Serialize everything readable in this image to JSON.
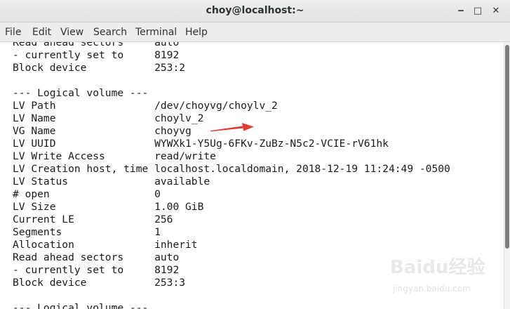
{
  "window": {
    "title": "choy@localhost:~",
    "minimize_glyph": "‒",
    "maximize_glyph": "□",
    "close_glyph": "✕"
  },
  "menu": [
    "File",
    "Edit",
    "View",
    "Search",
    "Terminal",
    "Help"
  ],
  "terminal": {
    "lines": [
      "Read ahead sectors     auto",
      "- currently set to     8192",
      "Block device           253:2",
      "",
      "--- Logical volume ---",
      "LV Path                /dev/choyvg/choylv_2",
      "LV Name                choylv_2",
      "VG Name                choyvg",
      "LV UUID                WYWXk1-Y5Ug-6FKv-ZuBz-N5c2-VCIE-rV61hk",
      "LV Write Access        read/write",
      "LV Creation host, time localhost.localdomain, 2018-12-19 11:24:49 -0500",
      "LV Status              available",
      "# open                 0",
      "LV Size                1.00 GiB",
      "Current LE             256",
      "Segments               1",
      "Allocation             inherit",
      "Read ahead sectors     auto",
      "- currently set to     8192",
      "Block device           253:3",
      "",
      "--- Logical volume ---"
    ]
  },
  "colors": {
    "annotation_arrow": "#e03c31"
  },
  "watermark": {
    "brand": "Baidu经验",
    "url": "jingyan.baidu.com"
  }
}
